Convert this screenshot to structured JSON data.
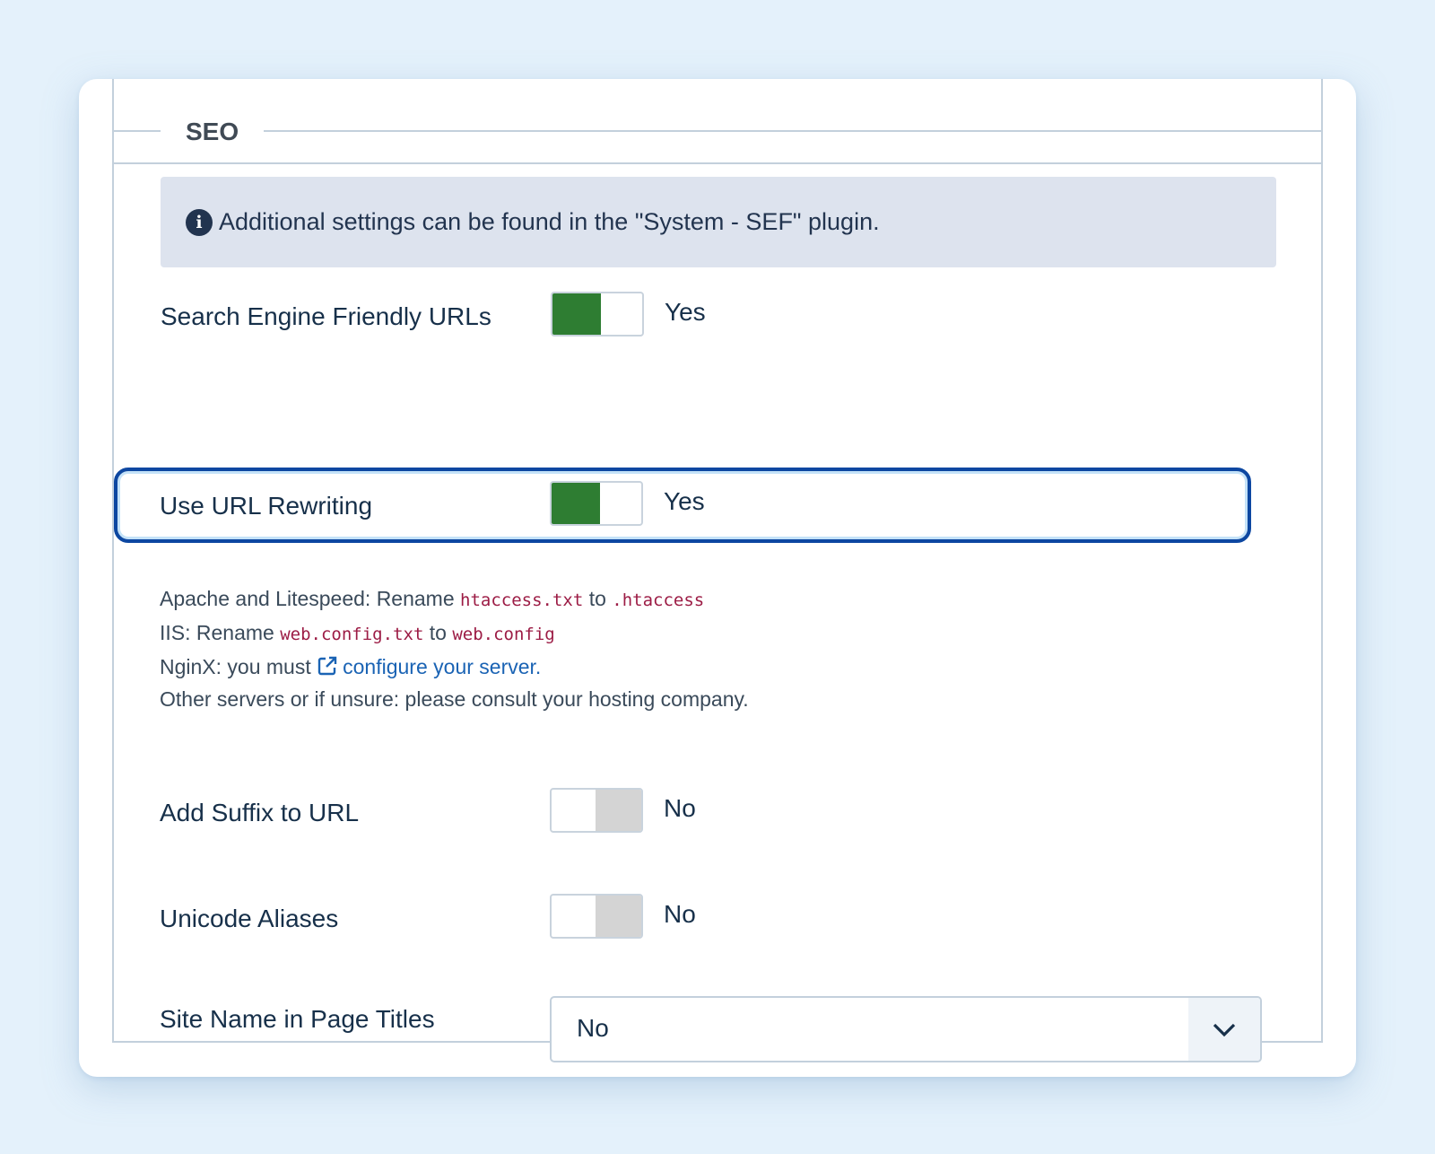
{
  "seo": {
    "legend": "SEO",
    "alert": "Additional settings can be found in the \"System - SEF\" plugin.",
    "info_icon_char": "i",
    "sef_urls": {
      "label": "Search Engine Friendly URLs",
      "state": "Yes",
      "on": true
    },
    "url_rewriting": {
      "label": "Use URL Rewriting",
      "state": "Yes",
      "on": true
    },
    "help": {
      "line1_prefix": "Apache and Litespeed: Rename",
      "line1_code1": "htaccess.txt",
      "line1_mid": "to",
      "line1_code2": ".htaccess",
      "line2_prefix": "IIS: Rename",
      "line2_code1": "web.config.txt",
      "line2_mid": "to",
      "line2_code2": "web.config",
      "line3_prefix": "NginX: you must",
      "line3_link": "configure your server.",
      "line4": "Other servers or if unsure: please consult your hosting company."
    },
    "suffix": {
      "label": "Add Suffix to URL",
      "state": "No",
      "on": false
    },
    "unicode": {
      "label": "Unicode Aliases",
      "state": "No",
      "on": false
    },
    "site_name": {
      "label": "Site Name in Page Titles",
      "value": "No"
    }
  },
  "colors": {
    "switch_on": "#2e7d32",
    "switch_off": "#d4d4d4",
    "focus": "#0d47a1",
    "link": "#1a63b4",
    "code": "#9c1c45"
  },
  "icons": {
    "info": "info-icon",
    "external_link": "external-link-icon",
    "select_arrow": "chevron-down-icon"
  }
}
